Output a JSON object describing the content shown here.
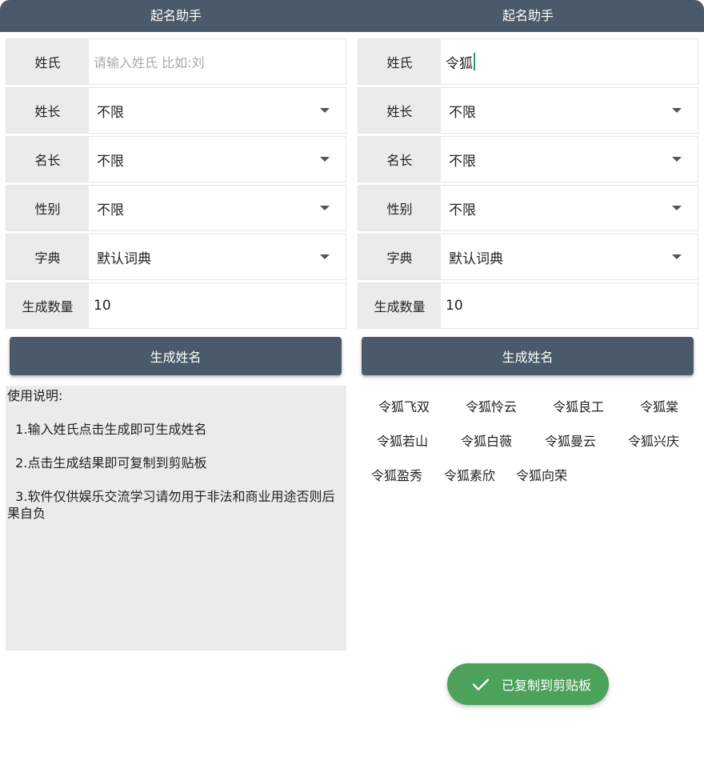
{
  "app": {
    "title_left": "起名助手",
    "title_right": "起名助手"
  },
  "left": {
    "surname_label": "姓氏",
    "surname_placeholder": "请输入姓氏 比如:刘",
    "surname_length_label": "姓长",
    "surname_length_value": "不限",
    "name_length_label": "名长",
    "name_length_value": "不限",
    "gender_label": "性别",
    "gender_value": "不限",
    "dictionary_label": "字典",
    "dictionary_value": "默认词典",
    "count_label": "生成数量",
    "count_value": "10",
    "generate_label": "生成姓名"
  },
  "right": {
    "surname_label": "姓氏",
    "surname_value": "令狐",
    "surname_length_label": "姓长",
    "surname_length_value": "不限",
    "name_length_label": "名长",
    "name_length_value": "不限",
    "gender_label": "性别",
    "gender_value": "不限",
    "dictionary_label": "字典",
    "dictionary_value": "默认词典",
    "count_label": "生成数量",
    "count_value": "10",
    "generate_label": "生成姓名"
  },
  "instructions": {
    "title": "使用说明:",
    "line1": "  1.输入姓氏点击生成即可生成姓名",
    "line2": "  2.点击生成结果即可复制到剪贴板",
    "line3": "  3.软件仅供娱乐交流学习请勿用于非法和商业用途否则后果自负"
  },
  "results": [
    "令狐飞双",
    "令狐怜云",
    "令狐良工",
    "令狐棠",
    "令狐若山",
    "令狐白薇",
    "令狐曼云",
    "令狐兴庆",
    "令狐盈秀",
    "令狐素欣",
    "令狐向荣"
  ],
  "toast": {
    "text": "已复制到剪贴板",
    "color": "#4ca25a"
  },
  "colors": {
    "header": "#4a5a6a",
    "label_bg": "#ebebeb",
    "cursor": "#1f9d6f"
  }
}
